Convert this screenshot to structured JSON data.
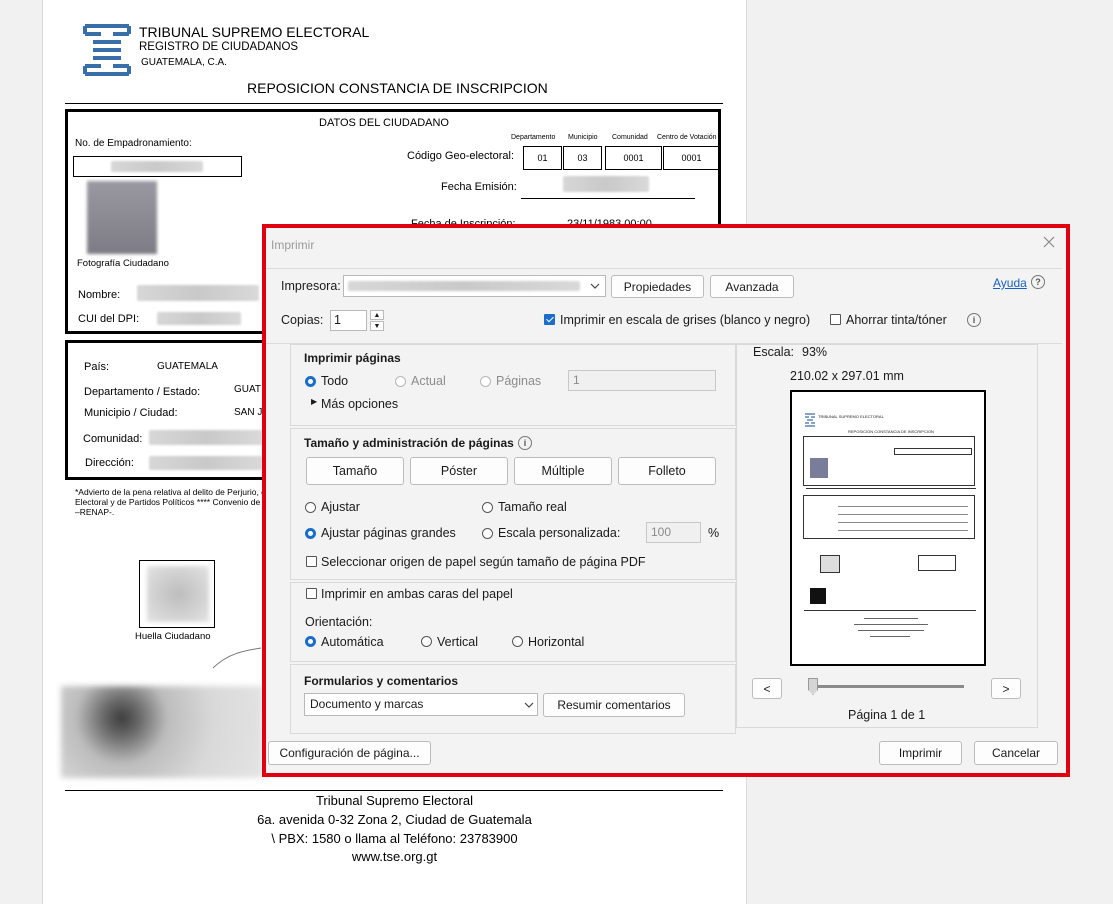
{
  "doc": {
    "org_line1": "TRIBUNAL SUPREMO ELECTORAL",
    "org_line2": "REGISTRO DE CIUDADANOS",
    "org_line3": "GUATEMALA, C.A.",
    "title": "REPOSICION CONSTANCIA DE INSCRIPCION",
    "section_title": "DATOS DEL CIUDADANO",
    "empadronamiento_label": "No. de Empadronamiento:",
    "geo_headers": [
      "Departamento",
      "Municipio",
      "Comunidad",
      "Centro de Votación"
    ],
    "geo_label": "Código Geo-electoral:",
    "geo_values": [
      "01",
      "03",
      "0001",
      "0001"
    ],
    "fecha_emision_label": "Fecha Emisión:",
    "fecha_inscripcion_label": "Fecha de Inscripción:",
    "fecha_inscripcion_value": "23/11/1983 00:00",
    "foto_label": "Fotografía Ciudadano",
    "nombre_label": "Nombre:",
    "cui_label": "CUI del DPI:",
    "pais_label": "País:",
    "pais_value": "GUATEMALA",
    "depto_label": "Departamento / Estado:",
    "depto_value": "GUAT",
    "muni_label": "Municipio / Ciudad:",
    "muni_value": "SAN J",
    "comunidad_label": "Comunidad:",
    "direccion_label": "Dirección:",
    "footnote_1": "*Advierto de la pena relativa al delito de Perjurio, c",
    "footnote_2": "Electoral y de Partidos Políticos **** Convenio de c",
    "footnote_3": "–RENAP-.",
    "huella_label": "Huella Ciudadano",
    "footer_1": "Tribunal Supremo Electoral",
    "footer_2": "6a. avenida 0-32 Zona 2, Ciudad de Guatemala",
    "footer_3": "\\ PBX: 1580 o llama al Teléfono: 23783900",
    "footer_4": "www.tse.org.gt"
  },
  "dialog": {
    "title": "Imprimir",
    "printer_label": "Impresora:",
    "properties_button": "Propiedades",
    "advanced_button": "Avanzada",
    "help_link": "Ayuda",
    "copies_label": "Copias:",
    "copies_value": "1",
    "grayscale_label": "Imprimir en escala de grises (blanco y negro)",
    "grayscale_checked": true,
    "save_ink_label": "Ahorrar tinta/tóner",
    "save_ink_checked": false,
    "pages_section": {
      "title": "Imprimir páginas",
      "all": "Todo",
      "current": "Actual",
      "pages": "Páginas",
      "pages_value": "1",
      "more_options": "Más opciones"
    },
    "size_section": {
      "title": "Tamaño y administración de páginas",
      "buttons": [
        "Tamaño",
        "Póster",
        "Múltiple",
        "Folleto"
      ],
      "fit": "Ajustar",
      "actual_size": "Tamaño real",
      "shrink_large": "Ajustar páginas grandes",
      "custom_scale": "Escala personalizada:",
      "custom_scale_value": "100",
      "percent": "%",
      "paper_source": "Seleccionar origen de papel según tamaño de página PDF"
    },
    "duplex_label": "Imprimir en ambas caras del papel",
    "orientation_label": "Orientación:",
    "orientation_options": [
      "Automática",
      "Vertical",
      "Horizontal"
    ],
    "forms_section": {
      "title": "Formularios y comentarios",
      "select_value": "Documento y marcas",
      "summarize_button": "Resumir comentarios"
    },
    "preview": {
      "scale_label": "Escala:",
      "scale_value": "93%",
      "dimensions": "210.02 x 297.01 mm",
      "page_indicator": "Página 1 de 1",
      "prev": "<",
      "next": ">",
      "mini_title": "REPOSICION CONSTANCIA DE INSCRIPCION",
      "mini_org": "TRIBUNAL SUPREMO ELECTORAL"
    },
    "page_setup_button": "Configuración de página...",
    "print_button": "Imprimir",
    "cancel_button": "Cancelar"
  },
  "colors": {
    "highlight_border": "#e00010",
    "accent": "#1a6dc9",
    "logo": "#3a6ea8"
  }
}
